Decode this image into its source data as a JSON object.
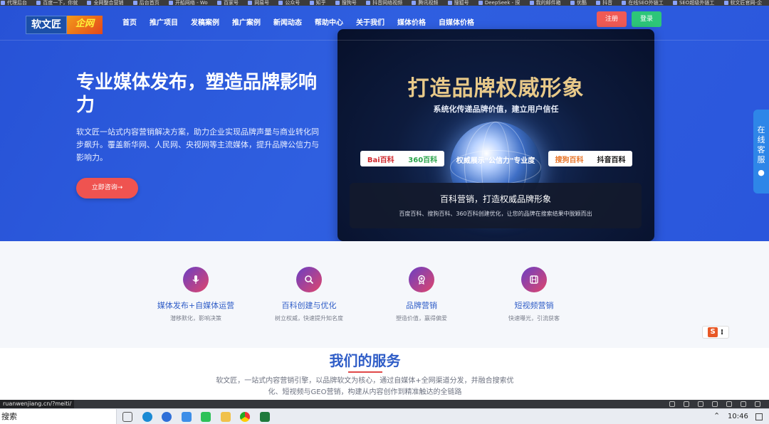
{
  "bookmarks": [
    "代理后台",
    "百度一下，你就",
    "全网整合营销",
    "后台首页",
    "开船网络 - Wo",
    "百家号",
    "网易号",
    "公众号",
    "知乎",
    "搜狗号",
    "抖音网络视频",
    "腾讯视频",
    "搜狐号",
    "DeepSeek - 探",
    "我的邮件箱",
    "优酷",
    "抖音",
    "在线SEO外链工",
    "SEO超级外链工",
    "软文匠官网-企"
  ],
  "header": {
    "logo_left": "软文匠",
    "logo_right": "企网",
    "nav": [
      "首页",
      "推广项目",
      "发稿案例",
      "推广案例",
      "新闻动态",
      "帮助中心",
      "关于我们",
      "媒体价格",
      "自媒体价格"
    ],
    "register": "注册",
    "login": "登录"
  },
  "hero": {
    "title": "专业媒体发布，塑造品牌影响力",
    "description": "软文匠一站式内容营销解决方案，助力企业实现品牌声量与商业转化同步飙升。覆盖新华网、人民网、央视网等主流媒体，提升品牌公信力与影响力。",
    "cta": "立即咨询→"
  },
  "banner": {
    "title": "打造品牌权威形象",
    "subtitle": "系统化传递品牌价值，建立用户信任",
    "left_logos": [
      "Bai百科",
      "360百科"
    ],
    "center_text": "权威展示\"公信力\"专业度",
    "right_logos": [
      "搜狗百科",
      "抖音百科"
    ],
    "caption_title": "百科营销，打造权威品牌形象",
    "caption_sub": "百度百科、搜狗百科、360百科创建优化，让您的品牌在搜索结果中脱颖而出"
  },
  "services": [
    {
      "icon": "microphone-icon",
      "title": "媒体发布+自媒体运营",
      "sub": "潜移默化，影响决策"
    },
    {
      "icon": "search-icon",
      "title": "百科创建与优化",
      "sub": "树立权威，快速提升知名度"
    },
    {
      "icon": "award-icon",
      "title": "品牌营销",
      "sub": "塑造价值，赢得偏爱"
    },
    {
      "icon": "film-icon",
      "title": "短视频营销",
      "sub": "快速曝光，引流获客"
    }
  ],
  "our_service": {
    "title": "我们的服务",
    "description": "软文匠，一站式内容营销引擎，以品牌软文为核心，通过自媒体+全网渠道分发，并融合搜索优化、短视频与GEO营销，构建从内容创作到精准触达的全链路"
  },
  "side_widget": "在线客服",
  "sogou": "S",
  "statusbar": {
    "url": "ruanwenjiang.cn/?meiti/"
  },
  "taskbar": {
    "search": "搜索",
    "time": "10:46"
  },
  "colors": {
    "hero_bg": "#2a56dc",
    "register": "#f05a55",
    "login": "#2dc679",
    "cta": "#ef5350",
    "accent_blue": "#2f5dc7"
  }
}
